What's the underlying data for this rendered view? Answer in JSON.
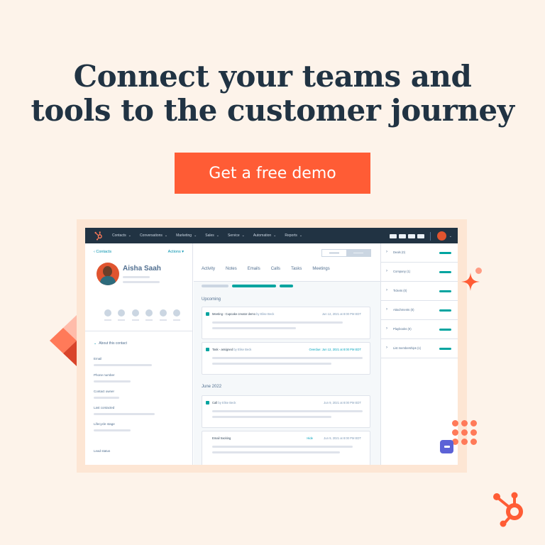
{
  "hero": {
    "headline_line1": "Connect your teams and",
    "headline_line2": "tools to the customer journey",
    "cta_label": "Get a free demo"
  },
  "colors": {
    "background": "#fdf3ea",
    "accent": "#ff5c35",
    "navy": "#213343",
    "teal": "#00a4a0",
    "chat": "#5c62d6"
  },
  "app": {
    "topnav": {
      "logo_icon": "hubspot-sprocket-icon",
      "items": [
        {
          "label": "Contacts"
        },
        {
          "label": "Conversations"
        },
        {
          "label": "Marketing"
        },
        {
          "label": "Sales"
        },
        {
          "label": "Service"
        },
        {
          "label": "Automation"
        },
        {
          "label": "Reports"
        }
      ],
      "caret": "⌄"
    },
    "contact": {
      "back_label": "‹ Contacts",
      "actions_label": "Actions ▾",
      "name": "Aisha Saah",
      "about_label": "About this contact",
      "about_chevron": "⌄",
      "properties": [
        {
          "label": "Email"
        },
        {
          "label": "Phone number"
        },
        {
          "label": "Contact owner"
        },
        {
          "label": "Last contacted"
        },
        {
          "label": "Lifecycle stage"
        },
        {
          "label": "Lead status"
        }
      ]
    },
    "timeline": {
      "tabs": [
        {
          "label": "Activity"
        },
        {
          "label": "Notes"
        },
        {
          "label": "Emails"
        },
        {
          "label": "Calls"
        },
        {
          "label": "Tasks"
        },
        {
          "label": "Meetings"
        }
      ],
      "upcoming_label": "Upcoming",
      "june_label": "June 2022",
      "cards": [
        {
          "title": "Meeting - Cupcake creator demo",
          "by": "by Elise Beck",
          "date": "Jun 12, 2021 at 8:00 PM EDT"
        },
        {
          "title": "Task - assigned",
          "by": "by Elise Beck",
          "date": "Overdue: Jun 12, 2021 at 8:00 PM EDT"
        },
        {
          "title": "Call",
          "by": "by Elise Beck",
          "date": "Jun 9, 2021 at 8:00 PM EDT"
        },
        {
          "title": "Email tracking",
          "by": "",
          "hide_label": "Hide",
          "date": "Jun 9, 2021 at 8:00 PM EDT"
        }
      ]
    },
    "associations": {
      "chevron": "›",
      "items": [
        {
          "label": "Deals (0)"
        },
        {
          "label": "Company (1)"
        },
        {
          "label": "Tickets (0)"
        },
        {
          "label": "Attachments (0)"
        },
        {
          "label": "Playbooks (0)"
        },
        {
          "label": "List memberships (1)"
        }
      ]
    }
  },
  "decorations": {
    "sparkle_icon": "sparkle-icon",
    "diamond_icon": "diamond-icon",
    "dot_grid_icon": "dot-grid-icon",
    "chat_icon": "chat-icon",
    "brand_logo": "hubspot-logo-icon"
  }
}
